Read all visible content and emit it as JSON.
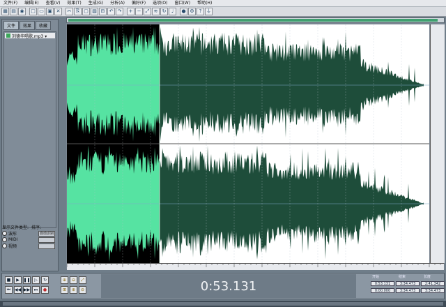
{
  "menu": [
    "文件(F)",
    "编辑(E)",
    "查看(V)",
    "效果(T)",
    "生成(G)",
    "分析(A)",
    "偏好(F)",
    "选项(O)",
    "窗口(W)",
    "帮助(H)"
  ],
  "toolbar": {
    "icons": [
      "waveform-edit-icon",
      "multitrack-icon",
      "cd-icon",
      "new-icon",
      "open-icon",
      "save-icon",
      "close-icon",
      "cut-icon",
      "copy-icon",
      "paste-icon",
      "mix-paste-icon",
      "trim-icon",
      "undo-icon",
      "redo-icon",
      "zoom-in-icon",
      "zoom-out-icon",
      "zoom-full-icon",
      "spectral-icon",
      "loop-icon",
      "metronome-icon",
      "record-icon",
      "settings-icon",
      "help-icon",
      "plug-icon"
    ]
  },
  "left_panel": {
    "tabs": [
      "文件",
      "效果",
      "收藏"
    ],
    "files": [
      "刘德华唱歌.mp3 ▾"
    ],
    "options_title": "显示文件类型:",
    "options_label": "排序:",
    "options": [
      "波形",
      "MIDI",
      "视频"
    ],
    "sort_value": "自动识别"
  },
  "waveform": {
    "selection_fraction": 0.255,
    "colors": {
      "selected": "#56e3a2",
      "unselected": "#1e4d3a",
      "background_left": "#000000",
      "background_right": "#ffffff"
    }
  },
  "transport": {
    "time": "0:53.131",
    "buttons": [
      "stop-icon",
      "play-icon",
      "pause-icon",
      "play-from-cursor-icon",
      "loop-play-icon",
      "rewind-start-icon",
      "rewind-icon",
      "fast-forward-icon",
      "end-icon",
      "record-icon"
    ],
    "zoom_buttons": [
      "zoom-in-h-icon",
      "zoom-out-h-icon",
      "zoom-full-icon",
      "zoom-sel-icon",
      "zoom-in-v-icon",
      "zoom-out-v-icon"
    ]
  },
  "selection": {
    "headers": [
      "开始",
      "结束",
      "长度"
    ],
    "row1": [
      "0:53.131",
      "3:34.473",
      "2:41.342"
    ],
    "row2": [
      "0:00.000",
      "3:34.473",
      "3:34.473"
    ]
  }
}
